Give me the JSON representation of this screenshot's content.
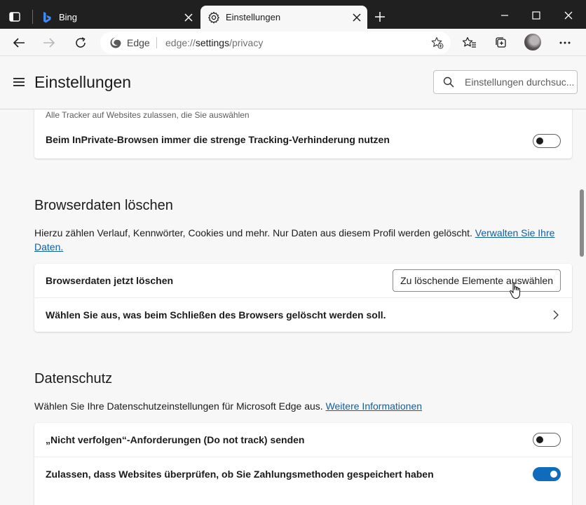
{
  "tabs": [
    {
      "title": "Bing",
      "icon": "bing-icon"
    },
    {
      "title": "Einstellungen",
      "icon": "gear-icon"
    }
  ],
  "address": {
    "site_label": "Edge",
    "url_prefix": "edge://",
    "url_host": "settings",
    "url_path": "/privacy"
  },
  "header": {
    "title": "Einstellungen",
    "search_placeholder": "Einstellungen durchsuc..."
  },
  "tracking": {
    "subtext": "Alle Tracker auf Websites zulassen, die Sie auswählen",
    "inprivate_label": "Beim InPrivate-Browsen immer die strenge Tracking-Verhinderung nutzen",
    "inprivate_on": false
  },
  "clear_data": {
    "title": "Browserdaten löschen",
    "description": "Hierzu zählen Verlauf, Kennwörter, Cookies und mehr. Nur Daten aus diesem Profil werden gelöscht.",
    "link": "Verwalten Sie Ihre Daten.",
    "row1_label": "Browserdaten jetzt löschen",
    "row1_button": "Zu löschende Elemente auswählen",
    "row2_label": "Wählen Sie aus, was beim Schließen des Browsers gelöscht werden soll."
  },
  "privacy": {
    "title": "Datenschutz",
    "description": "Wählen Sie Ihre Datenschutzeinstellungen für Microsoft Edge aus.",
    "link": "Weitere Informationen",
    "dnt_label": "„Nicht verfolgen“-Anforderungen (Do not track) senden",
    "dnt_on": false,
    "payment_label": "Zulassen, dass Websites überprüfen, ob Sie Zahlungsmethoden gespeichert haben",
    "payment_on": true
  },
  "colors": {
    "accent": "#0f6cbd",
    "link": "#115ea3",
    "chrome_dark": "#202020",
    "page_bg": "#f7f7f7"
  }
}
